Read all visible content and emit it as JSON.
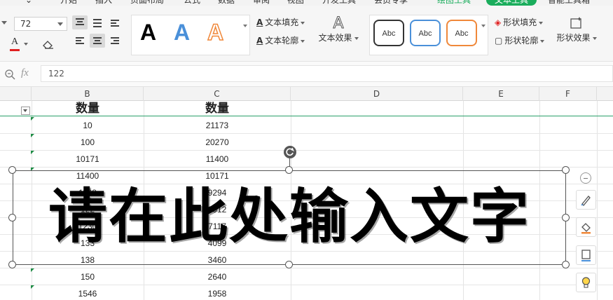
{
  "ribbon_tabs": [
    {
      "label": "开始"
    },
    {
      "label": "插入"
    },
    {
      "label": "页面布局"
    },
    {
      "label": "公式"
    },
    {
      "label": "数据"
    },
    {
      "label": "审阅"
    },
    {
      "label": "视图"
    },
    {
      "label": "开发工具"
    },
    {
      "label": "会员专享"
    },
    {
      "label": "绘图工具"
    },
    {
      "label": "文本工具"
    },
    {
      "label": "智能工具箱"
    }
  ],
  "ribbon": {
    "font_size": "72",
    "text_style_preview": "A",
    "text_fill_label": "文本填充",
    "text_outline_label": "文本轮廓",
    "text_effects_label": "文本效果",
    "shape_style_preview": "Abc",
    "shape_fill_label": "形状填充",
    "shape_outline_label": "形状轮廓",
    "shape_effects_label": "形状效果"
  },
  "formula_bar": {
    "fx_label": "fx",
    "value": "122"
  },
  "columns": [
    "B",
    "C",
    "D",
    "E",
    "F"
  ],
  "table": {
    "headers": [
      "数量",
      "数量"
    ],
    "rows": [
      [
        "10",
        "21173"
      ],
      [
        "100",
        "20270"
      ],
      [
        "10171",
        "11400"
      ],
      [
        "11400",
        "10171"
      ],
      [
        "1168",
        "9294"
      ],
      [
        "122",
        "8912"
      ],
      [
        "1230",
        "7117"
      ],
      [
        "133",
        "4099"
      ],
      [
        "138",
        "3460"
      ],
      [
        "150",
        "2640"
      ],
      [
        "1546",
        "1958"
      ]
    ]
  },
  "textbox": {
    "text": "请在此处输入文字"
  },
  "colors": {
    "accent": "#1aad5c",
    "font_color": "#e02020",
    "style_blue": "#4a90d9",
    "style_orange": "#f0883a"
  },
  "icons": {
    "rotate": "rotate-icon",
    "collapse": "minus-circle-icon",
    "brush": "brush-icon",
    "fill": "paint-bucket-icon",
    "outline": "shape-outline-icon",
    "idea": "lightbulb-icon"
  }
}
